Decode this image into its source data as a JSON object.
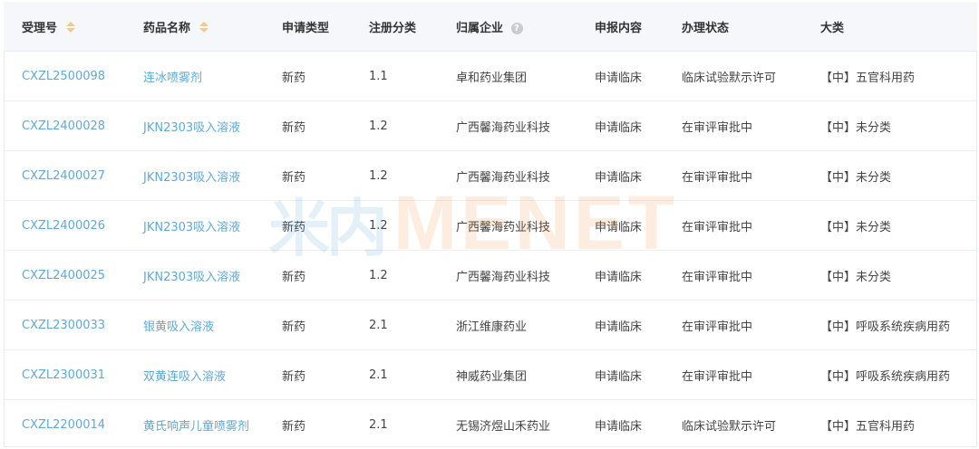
{
  "table": {
    "headers": [
      {
        "label": "受理号",
        "sortable": true
      },
      {
        "label": "药品名称",
        "sortable": true
      },
      {
        "label": "申请类型",
        "sortable": false
      },
      {
        "label": "注册分类",
        "sortable": false
      },
      {
        "label": "归属企业",
        "sortable": false,
        "help": true
      },
      {
        "label": "申报内容",
        "sortable": false
      },
      {
        "label": "办理状态",
        "sortable": false
      },
      {
        "label": "大类",
        "sortable": false
      }
    ],
    "help_glyph": "?",
    "rows": [
      [
        "CXZL2500098",
        "连冰喷雾剂",
        "新药",
        "1.1",
        "卓和药业集团",
        "申请临床",
        "临床试验默示许可",
        "【中】五官科用药"
      ],
      [
        "CXZL2400028",
        "JKN2303吸入溶液",
        "新药",
        "1.2",
        "广西馨海药业科技",
        "申请临床",
        "在审评审批中",
        "【中】未分类"
      ],
      [
        "CXZL2400027",
        "JKN2303吸入溶液",
        "新药",
        "1.2",
        "广西馨海药业科技",
        "申请临床",
        "在审评审批中",
        "【中】未分类"
      ],
      [
        "CXZL2400026",
        "JKN2303吸入溶液",
        "新药",
        "1.2",
        "广西馨海药业科技",
        "申请临床",
        "在审评审批中",
        "【中】未分类"
      ],
      [
        "CXZL2400025",
        "JKN2303吸入溶液",
        "新药",
        "1.2",
        "广西馨海药业科技",
        "申请临床",
        "在审评审批中",
        "【中】未分类"
      ],
      [
        "CXZL2300033",
        "银黄吸入溶液",
        "新药",
        "2.1",
        "浙江维康药业",
        "申请临床",
        "在审评审批中",
        "【中】呼吸系统疾病用药"
      ],
      [
        "CXZL2300031",
        "双黄连吸入溶液",
        "新药",
        "2.1",
        "神威药业集团",
        "申请临床",
        "在审评审批中",
        "【中】呼吸系统疾病用药"
      ],
      [
        "CXZL2200014",
        "黄氏响声儿童喷雾剂",
        "新药",
        "2.1",
        "无锡济煜山禾药业",
        "申请临床",
        "临床试验默示许可",
        "【中】五官科用药"
      ]
    ]
  },
  "watermark": {
    "cn": "米内",
    "en": "MENET"
  },
  "colors": {
    "link": "#5fa9d8",
    "sort_arrow": "#f5c98a",
    "header_bg": "#f5f7fa",
    "watermark_blue": "#3a8fd0",
    "watermark_orange": "#f07a1a"
  }
}
